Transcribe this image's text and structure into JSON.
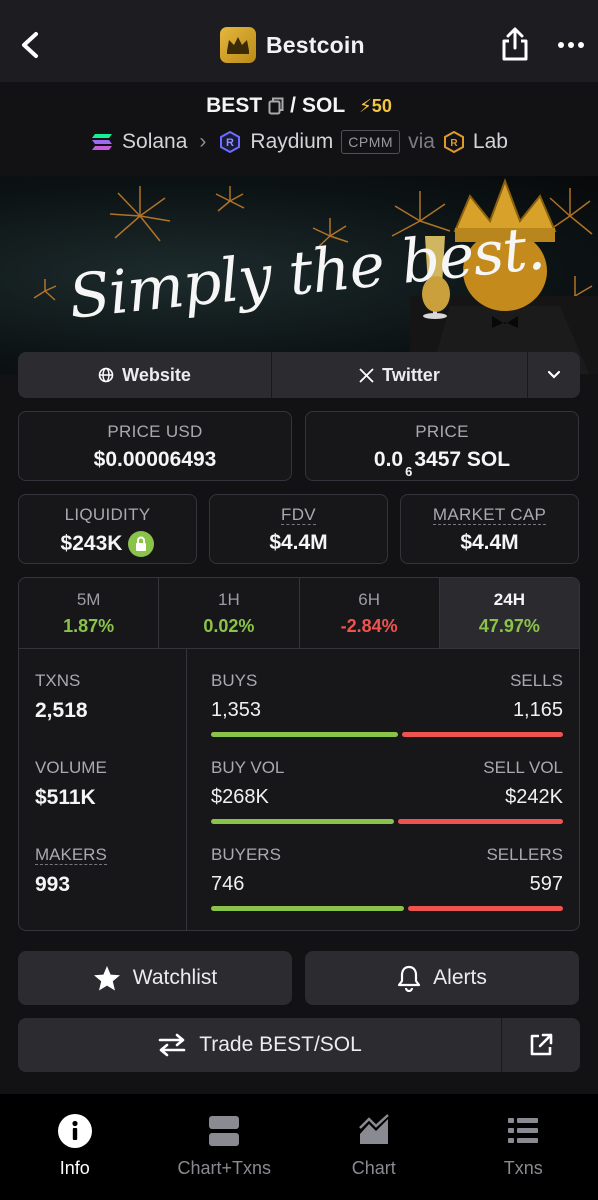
{
  "header": {
    "title": "Bestcoin"
  },
  "pair": {
    "base": "BEST",
    "separator": "/",
    "quote": "SOL",
    "boost": "⚡50",
    "chain": "Solana",
    "dex": "Raydium",
    "pool_type": "CPMM",
    "via_label": "via",
    "via": "Lab"
  },
  "banner": {
    "text": "Simply the best."
  },
  "links": {
    "website": "Website",
    "twitter": "Twitter"
  },
  "price": {
    "usd_label": "PRICE USD",
    "usd_value": "$0.00006493",
    "native_label": "PRICE",
    "native_prefix": "0.0",
    "native_zeros": "6",
    "native_digits": "3457 SOL"
  },
  "metrics": {
    "liquidity_label": "LIQUIDITY",
    "liquidity_value": "$243K",
    "fdv_label": "FDV",
    "fdv_value": "$4.4M",
    "mcap_label": "MARKET CAP",
    "mcap_value": "$4.4M"
  },
  "timeframes": [
    {
      "label": "5M",
      "change": "1.87%"
    },
    {
      "label": "1H",
      "change": "0.02%"
    },
    {
      "label": "6H",
      "change": "-2.84%"
    },
    {
      "label": "24H",
      "change": "47.97%"
    }
  ],
  "activity": {
    "txns_label": "TXNS",
    "txns_value": "2,518",
    "volume_label": "VOLUME",
    "volume_value": "$511K",
    "makers_label": "MAKERS",
    "makers_value": "993",
    "buys_label": "BUYS",
    "buys_value": "1,353",
    "sells_label": "SELLS",
    "sells_value": "1,165",
    "buyvol_label": "BUY VOL",
    "buyvol_value": "$268K",
    "sellvol_label": "SELL VOL",
    "sellvol_value": "$242K",
    "buyers_label": "BUYERS",
    "buyers_value": "746",
    "sellers_label": "SELLERS",
    "sellers_value": "597",
    "buy_fraction": 0.537,
    "buyvol_fraction": 0.525,
    "buyers_fraction": 0.555
  },
  "actions": {
    "watchlist": "Watchlist",
    "alerts": "Alerts",
    "trade": "Trade BEST/SOL"
  },
  "nav": {
    "info": "Info",
    "chart_txns": "Chart+Txns",
    "chart": "Chart",
    "txns": "Txns"
  },
  "colors": {
    "positive": "#8bc34a",
    "negative": "#ef5350",
    "background": "#121214",
    "brand": "#e6b73d"
  }
}
